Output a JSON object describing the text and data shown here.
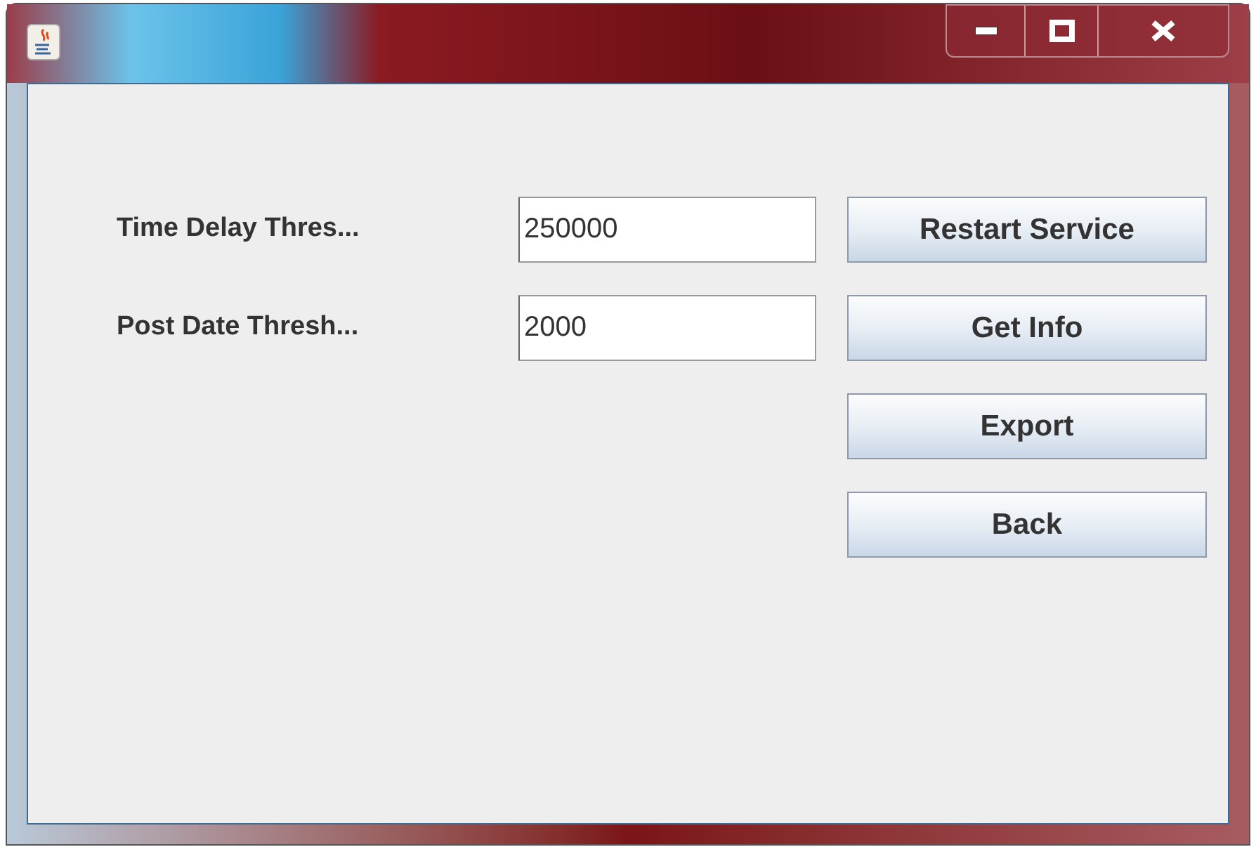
{
  "fields": [
    {
      "label": "Time Delay Thres...",
      "value": "250000"
    },
    {
      "label": "Post Date Thresh...",
      "value": "2000"
    }
  ],
  "buttons": [
    "Restart Service",
    "Get Info",
    "Export",
    "Back"
  ]
}
